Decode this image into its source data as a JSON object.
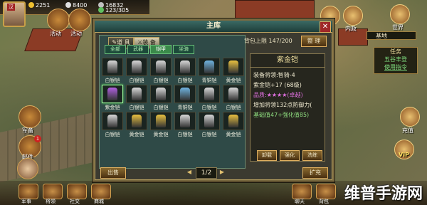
{
  "hud": {
    "vip_tag": "汉",
    "gold": "2251",
    "grain": "8400",
    "silver": "16832",
    "troops": "123/305",
    "activity_label": "活动",
    "event_label": "活动",
    "sale_label": "军备",
    "mail_label": "邮件",
    "event_badge": "1"
  },
  "right_hud": {
    "battle": "战场",
    "politics": "内政",
    "world": "世界",
    "location": "基地",
    "task_title": "任务",
    "task_name": "五谷丰登",
    "task_action": "使用指令",
    "recharge": "充值",
    "vip": "VIP"
  },
  "panel": {
    "title": "主库",
    "close": "✕",
    "tab_item": "道 具",
    "tab_equip": "装 备",
    "capacity": "背包上限   147/200",
    "sort_button": "整 理",
    "filters": [
      "全部",
      "武器",
      "铠甲",
      "坐骑"
    ],
    "active_filter": 2,
    "items": [
      {
        "label": "白银铠",
        "color": "#d8d8d8"
      },
      {
        "label": "白银铠",
        "color": "#d8d8d8"
      },
      {
        "label": "白银铠",
        "color": "#d8d8d8"
      },
      {
        "label": "白银铠",
        "color": "#d8d8d8"
      },
      {
        "label": "青铜铠",
        "color": "#6fb3e0"
      },
      {
        "label": "黄金铠",
        "color": "#e8c040"
      },
      {
        "label": "紫金铠",
        "color": "#b060e0",
        "selected": true
      },
      {
        "label": "白银铠",
        "color": "#d8d8d8"
      },
      {
        "label": "白银铠",
        "color": "#d8d8d8"
      },
      {
        "label": "青铜铠",
        "color": "#6fb3e0"
      },
      {
        "label": "白银铠",
        "color": "#d8d8d8"
      },
      {
        "label": "白银铠",
        "color": "#d8d8d8"
      },
      {
        "label": "白银铠",
        "color": "#d8d8d8"
      },
      {
        "label": "黄金铠",
        "color": "#e8c040"
      },
      {
        "label": "黄金铠",
        "color": "#e8c040"
      },
      {
        "label": "白银铠",
        "color": "#d8d8d8"
      },
      {
        "label": "白银铠",
        "color": "#d8d8d8"
      },
      {
        "label": "黄金铠",
        "color": "#e8c040"
      }
    ],
    "detail": {
      "name": "紫金铠",
      "lines": [
        {
          "text": "装备将领:智骑-4",
          "cls": ""
        },
        {
          "text": "紫金铠+17 (68级)",
          "cls": ""
        },
        {
          "text": "品质:★★★★(卓越)",
          "cls": "p"
        },
        {
          "text": "增加将领132点防御力(",
          "cls": ""
        },
        {
          "text": "基础值47+强化值85)",
          "cls": "g"
        }
      ],
      "btn_unload": "卸载",
      "btn_strengthen": "强化",
      "btn_refine": "洗练"
    },
    "footer": {
      "left_btn": "出售",
      "page": "1/2",
      "right_btn": "扩充"
    }
  },
  "bottom": {
    "items": [
      "军事",
      "将领",
      "社交",
      "商城"
    ],
    "right_items": [
      "聊天",
      "背包"
    ],
    "watermark": "维普手游网"
  }
}
